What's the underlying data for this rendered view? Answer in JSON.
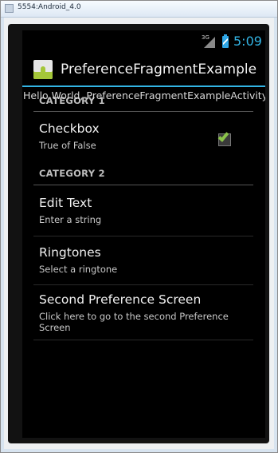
{
  "window": {
    "title": "5554:Android_4.0"
  },
  "status_bar": {
    "network": "3G",
    "time": "5:09"
  },
  "action_bar": {
    "title": "PreferenceFragmentExample"
  },
  "hello_text": "Hello World, PreferenceFragmentExampleActivity!",
  "categories": [
    {
      "title": "CATEGORY 1",
      "items": [
        {
          "title": "Checkbox",
          "summary": "True of False",
          "checked": true
        }
      ]
    },
    {
      "title": "CATEGORY 2",
      "items": [
        {
          "title": "Edit Text",
          "summary": "Enter a string"
        },
        {
          "title": "Ringtones",
          "summary": "Select a ringtone"
        },
        {
          "title": "Second Preference Screen",
          "summary": "Click here to go to the second Preference Screen"
        }
      ]
    }
  ],
  "colors": {
    "accent": "#33b5e5",
    "checkbox_check": "#8bc34a",
    "background": "#000000"
  }
}
